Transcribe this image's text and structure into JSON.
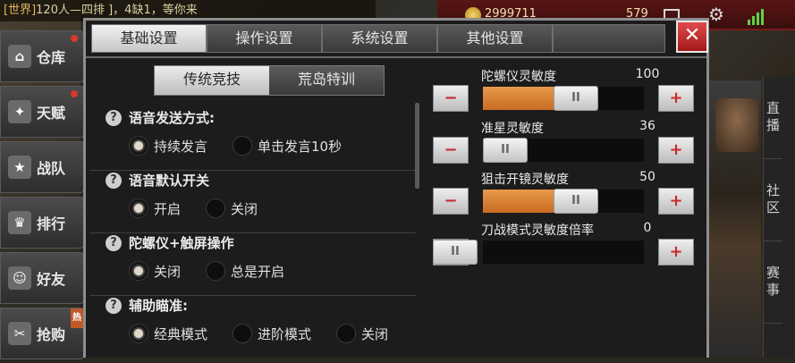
{
  "chat": {
    "channel": "[世界]",
    "message": "120人—四排 ]，4缺1，等你来"
  },
  "topbar": {
    "coins": "2999711",
    "gems": "579"
  },
  "left_menu": [
    {
      "label": "仓库",
      "icon": "warehouse-icon",
      "glyph": "⌂",
      "dot": true
    },
    {
      "label": "天赋",
      "icon": "talent-icon",
      "glyph": "✦",
      "dot": true
    },
    {
      "label": "战队",
      "icon": "team-icon",
      "glyph": "★",
      "dot": false
    },
    {
      "label": "排行",
      "icon": "trophy-icon",
      "glyph": "♛",
      "dot": false
    },
    {
      "label": "好友",
      "icon": "friends-icon",
      "glyph": "☺",
      "dot": false
    },
    {
      "label": "抢购",
      "icon": "shop-icon",
      "glyph": "✂",
      "dot": false,
      "badge": "热"
    }
  ],
  "right_tabs": [
    "直播",
    "社区",
    "赛事"
  ],
  "dialog": {
    "tabs": [
      "基础设置",
      "操作设置",
      "系统设置",
      "其他设置"
    ],
    "active_tab": 0,
    "close_label": "✕",
    "subtabs": [
      "传统竞技",
      "荒岛特训"
    ],
    "active_subtab": 0,
    "options": [
      {
        "title": "语音发送方式:",
        "choices": [
          "持续发言",
          "单击发言10秒"
        ],
        "selected": 0
      },
      {
        "title": "语音默认开关",
        "choices": [
          "开启",
          "关闭"
        ],
        "selected": 0
      },
      {
        "title": "陀螺仪+触屏操作",
        "choices": [
          "关闭",
          "总是开启"
        ],
        "selected": 0
      },
      {
        "title": "辅助瞄准:",
        "choices": [
          "经典模式",
          "进阶模式",
          "关闭"
        ],
        "selected": 0
      }
    ],
    "sliders": [
      {
        "label": "陀螺仪灵敏度",
        "value": "100",
        "level": 0.55
      },
      {
        "label": "准星灵敏度",
        "value": "36",
        "level": 0.1
      },
      {
        "label": "狙击开镜灵敏度",
        "value": "50",
        "level": 0.55
      },
      {
        "label": "刀战模式灵敏度倍率",
        "value": "0",
        "level": 0.0
      }
    ],
    "minus_label": "−",
    "plus_label": "+",
    "thumb_label": "II"
  }
}
